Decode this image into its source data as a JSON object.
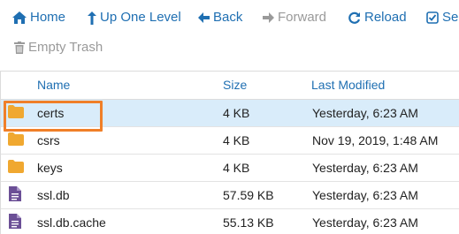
{
  "toolbar": {
    "home": "Home",
    "up_one_level": "Up One Level",
    "back": "Back",
    "forward": "Forward",
    "reload": "Reload",
    "select_all_partial": "Sele",
    "empty_trash": "Empty Trash"
  },
  "table": {
    "headers": {
      "name": "Name",
      "size": "Size",
      "modified": "Last Modified"
    },
    "rows": [
      {
        "name": "certs",
        "size": "4 KB",
        "modified": "Yesterday, 6:23 AM",
        "type": "folder",
        "selected": true
      },
      {
        "name": "csrs",
        "size": "4 KB",
        "modified": "Nov 19, 2019, 1:48 AM",
        "type": "folder",
        "selected": false
      },
      {
        "name": "keys",
        "size": "4 KB",
        "modified": "Yesterday, 6:23 AM",
        "type": "folder",
        "selected": false
      },
      {
        "name": "ssl.db",
        "size": "57.59 KB",
        "modified": "Yesterday, 6:23 AM",
        "type": "file",
        "selected": false
      },
      {
        "name": "ssl.db.cache",
        "size": "55.13 KB",
        "modified": "Yesterday, 6:23 AM",
        "type": "file",
        "selected": false
      }
    ]
  },
  "colors": {
    "link": "#1f6fb2",
    "folder": "#f0a830",
    "file": "#6b4f96",
    "highlight": "#f07f28",
    "selected_row": "#d9ecfa"
  }
}
